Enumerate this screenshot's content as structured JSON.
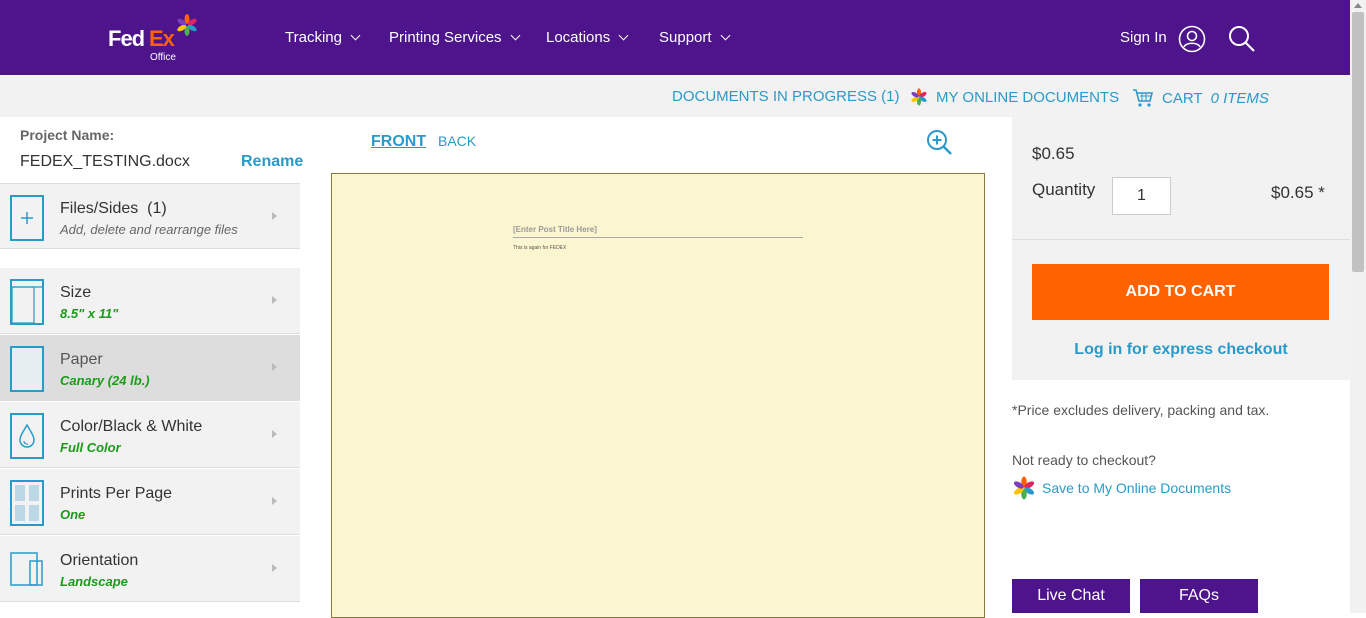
{
  "logo": {
    "fed": "Fed",
    "ex": "Ex",
    "office": "Office"
  },
  "nav": {
    "items": [
      {
        "label": "Tracking"
      },
      {
        "label": "Printing Services"
      },
      {
        "label": "Locations"
      },
      {
        "label": "Support"
      }
    ],
    "signin": "Sign In"
  },
  "subbar": {
    "docs_in_progress": "DOCUMENTS IN PROGRESS (1)",
    "my_online_docs": "MY ONLINE DOCUMENTS",
    "cart_label": "CART",
    "cart_items": "0 ITEMS"
  },
  "project": {
    "label": "Project Name:",
    "name": "FEDEX_TESTING.docx",
    "rename": "Rename"
  },
  "options": [
    {
      "title": "Files/Sides  (1)",
      "sub": "Add, delete and rearrange files"
    },
    {
      "title": "Size",
      "sub": "8.5\" x 11\""
    },
    {
      "title": "Paper",
      "sub": "Canary (24 lb.)"
    },
    {
      "title": "Color/Black & White",
      "sub": "Full Color"
    },
    {
      "title": "Prints Per Page",
      "sub": "One"
    },
    {
      "title": "Orientation",
      "sub": "Landscape"
    }
  ],
  "preview": {
    "front": "FRONT",
    "back": "BACK",
    "doc_title": "[Enter Post Title Here]",
    "doc_body": "This is again for FEDEX"
  },
  "pricing": {
    "unit_price": "$0.65",
    "qty_label": "Quantity",
    "qty_value": "1",
    "total": "$0.65 *",
    "add_to_cart": "ADD TO CART",
    "express": "Log in for express checkout",
    "exclusion": "*Price excludes delivery, packing and tax.",
    "not_ready": "Not ready to checkout?",
    "save_online": "Save to My Online Documents"
  },
  "footer": {
    "live_chat": "Live Chat",
    "faqs": "FAQs"
  },
  "colors": {
    "brand_purple": "#4d148c",
    "brand_orange": "#ff6200",
    "link_blue": "#2a9ac8",
    "selection_green": "#1a9c1a",
    "paper_canary": "#fbf6cf"
  }
}
